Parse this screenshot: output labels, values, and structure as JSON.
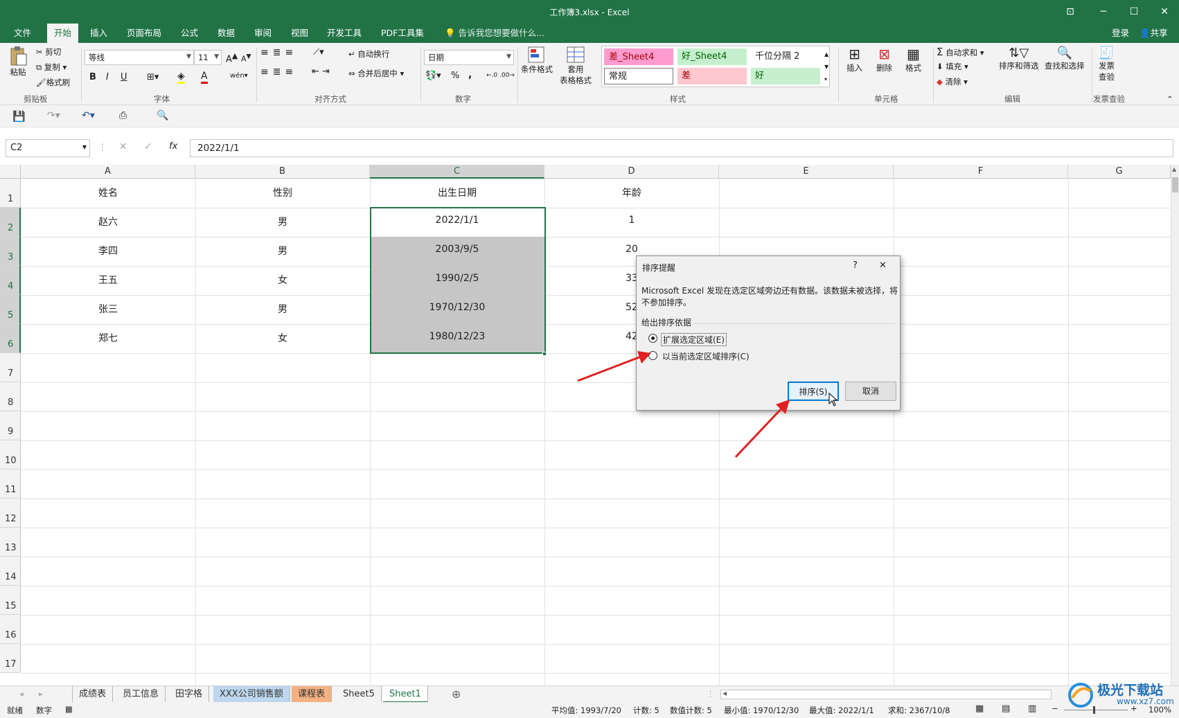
{
  "window": {
    "title": "工作簿3.xlsx - Excel"
  },
  "ribbon_tabs": [
    "文件",
    "开始",
    "插入",
    "页面布局",
    "公式",
    "数据",
    "审阅",
    "视图",
    "开发工具",
    "PDF工具集"
  ],
  "tell_me": "告诉我您想要做什么...",
  "account": {
    "login": "登录",
    "share": "共享"
  },
  "clipboard": {
    "paste": "粘贴",
    "cut": "剪切",
    "copy": "复制",
    "format_painter": "格式刷",
    "group": "剪贴板"
  },
  "font": {
    "name": "等线",
    "size": "11",
    "group": "字体",
    "bold": "B",
    "italic": "I",
    "underline": "U",
    "grow": "A",
    "shrink": "A"
  },
  "alignment": {
    "wrap": "自动换行",
    "merge": "合并后居中",
    "group": "对齐方式"
  },
  "number": {
    "format": "日期",
    "percent": "%",
    "comma": ",",
    "group": "数字"
  },
  "styles": {
    "conditional": "条件格式",
    "table_format_1": "套用",
    "table_format_2": "表格格式",
    "group": "样式",
    "cells": [
      "差_Sheet4",
      "好_Sheet4",
      "千位分隔 2",
      "常规",
      "差",
      "好"
    ]
  },
  "cells_group": {
    "insert": "插入",
    "delete": "删除",
    "format": "格式",
    "group": "单元格"
  },
  "editing": {
    "autosum": "自动求和",
    "fill": "填充",
    "clear": "清除",
    "sort_filter": "排序和筛选",
    "find_select": "查找和选择",
    "group": "编辑"
  },
  "invoice": {
    "label1": "发票",
    "label2": "查验",
    "group": "发票查验"
  },
  "formula_bar": {
    "name_box": "C2",
    "fx": "fx",
    "value": "2022/1/1"
  },
  "columns": [
    "A",
    "B",
    "C",
    "D",
    "E",
    "F",
    "G"
  ],
  "rows": [
    "1",
    "2",
    "3",
    "4",
    "5",
    "6",
    "7",
    "8",
    "9",
    "10",
    "11",
    "12",
    "13",
    "14",
    "15",
    "16",
    "17"
  ],
  "table": {
    "headers": [
      "姓名",
      "性别",
      "出生日期",
      "年龄"
    ],
    "rows": [
      [
        "赵六",
        "男",
        "2022/1/1",
        "1"
      ],
      [
        "李四",
        "男",
        "2003/9/5",
        "20"
      ],
      [
        "王五",
        "女",
        "1990/2/5",
        "33"
      ],
      [
        "张三",
        "男",
        "1970/12/30",
        "52"
      ],
      [
        "郑七",
        "女",
        "1980/12/23",
        "42"
      ]
    ]
  },
  "sheets": [
    "成绩表",
    "员工信息",
    "田字格",
    "XXX公司销售额",
    "课程表",
    "Sheet5",
    "Sheet1"
  ],
  "sheet_colors": {
    "XXX公司销售额": "#bdd7ee",
    "课程表": "#f4b183"
  },
  "status": {
    "ready": "就绪",
    "numlock": "数字",
    "average": "平均值: 1993/7/20",
    "count": "计数: 5",
    "numcount": "数值计数: 5",
    "min": "最小值: 1970/12/30",
    "max": "最大值: 2022/1/1",
    "sum": "求和: 2367/10/8",
    "zoom": "100%"
  },
  "dialog": {
    "title": "排序提醒",
    "help": "?",
    "close": "✕",
    "message_line1": "Microsoft Excel 发现在选定区域旁边还有数据。该数据未被选择，将",
    "message_line2": "不参加排序。",
    "group_label": "给出排序依据",
    "option_expand": "扩展选定区域(E)",
    "option_current": "以当前选定区域排序(C)",
    "sort_button": "排序(S)",
    "cancel_button": "取消"
  },
  "watermark": {
    "brand": "极光下载站",
    "url": "www.xz7.com"
  },
  "colors": {
    "excel_green": "#217346",
    "arrow_red": "#e02020",
    "selection_fill": "#c6c6c6"
  }
}
